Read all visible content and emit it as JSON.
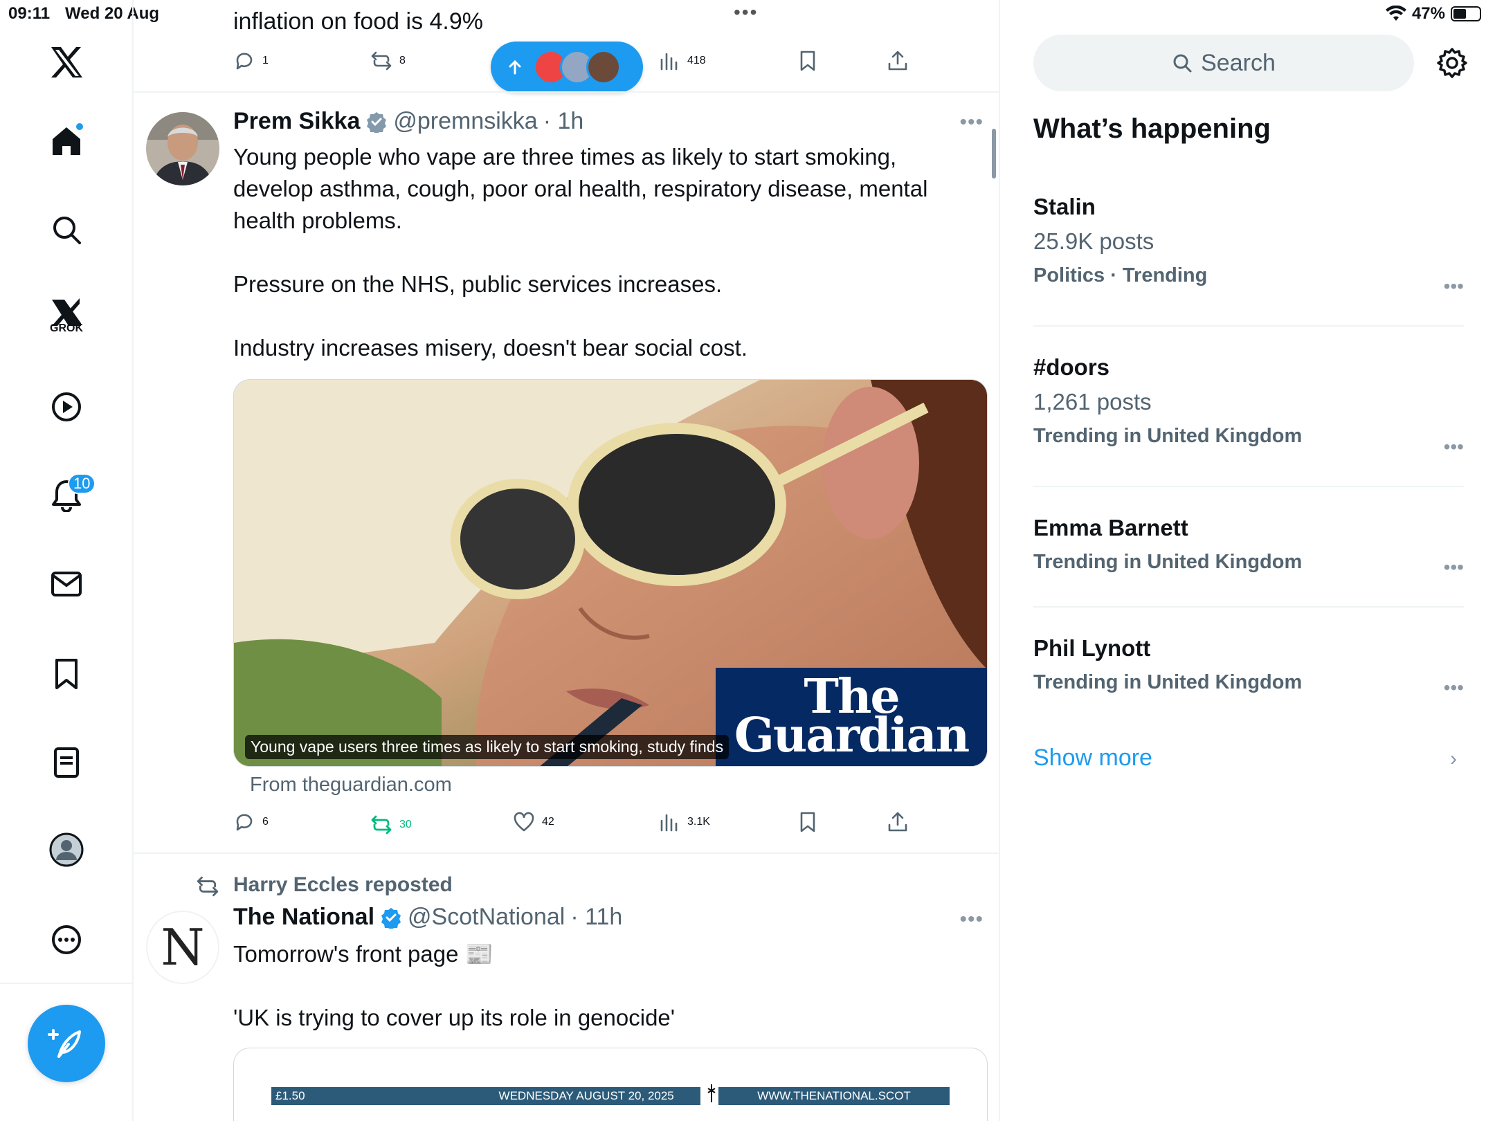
{
  "status_bar": {
    "time": "09:11",
    "date": "Wed 20 Aug",
    "battery": "47%"
  },
  "nav": {
    "notifications_count": "10",
    "grok_label": "GROK"
  },
  "feed": {
    "prev_tweet": {
      "text_tail": "inflation on food is 4.9%",
      "replies": "1",
      "reposts": "8",
      "views": "418"
    },
    "tweet1": {
      "name": "Prem Sikka",
      "handle": "@premnsikka",
      "time": "· 1h",
      "text": "Young people who vape are three times as likely to start smoking, develop asthma, cough, poor oral health, respiratory disease, mental health problems.\n\nPressure on the NHS, public services increases.\n\nIndustry increases misery, doesn't bear social cost.",
      "card_caption": "Young vape users three times as likely to start smoking, study finds",
      "card_logo_line1": "The",
      "card_logo_line2": "Guardian",
      "card_source": "From theguardian.com",
      "replies": "6",
      "reposts": "30",
      "likes": "42",
      "views": "3.1K"
    },
    "tweet2": {
      "repost_by": "Harry Eccles reposted",
      "avatar_letter": "N",
      "name": "The National",
      "handle": "@ScotNational",
      "time": "· 11h",
      "text_line1": "Tomorrow's front page 📰",
      "text_line2": "'UK is trying to cover up its role in genocide'",
      "paper_price": "£1.50",
      "paper_date": "WEDNESDAY AUGUST 20, 2025",
      "paper_url": "WWW.THENATIONAL.SCOT"
    }
  },
  "sidebar": {
    "search_placeholder": "Search",
    "title": "What’s happening",
    "trends": [
      {
        "name": "Stalin",
        "posts": "25.9K posts",
        "category": "Politics · Trending"
      },
      {
        "name": "#doors",
        "posts": "1,261 posts",
        "category": "Trending in United Kingdom"
      },
      {
        "name": "Emma Barnett",
        "posts": "",
        "category": "Trending in United Kingdom"
      },
      {
        "name": "Phil Lynott",
        "posts": "",
        "category": "Trending in United Kingdom"
      }
    ],
    "show_more": "Show more"
  },
  "colors": {
    "accent": "#1d9bf0",
    "muted": "#536471",
    "repost_green": "#00ba7c",
    "guardian_blue": "#052962"
  }
}
